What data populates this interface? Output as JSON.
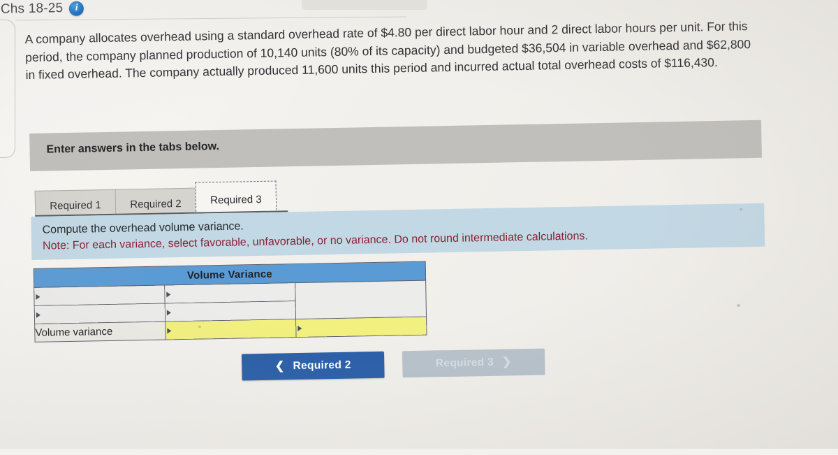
{
  "header": {
    "title": "Chs 18-25",
    "info_icon": "info-circle-icon"
  },
  "problem": {
    "text": "A company allocates overhead using a standard overhead rate of $4.80 per direct labor hour and 2 direct labor hours per unit. For this period, the company planned production of 10,140 units (80% of its capacity) and budgeted $36,504 in variable overhead and $62,800 in fixed overhead. The company actually produced 11,600 units this period and incurred actual total overhead costs of $116,430."
  },
  "instruction_band": {
    "text": "Enter answers in the tabs below."
  },
  "tabs": [
    {
      "label": "Required 1",
      "active": false
    },
    {
      "label": "Required 2",
      "active": false
    },
    {
      "label": "Required 3",
      "active": true
    }
  ],
  "panel": {
    "line1": "Compute the overhead volume variance.",
    "line2": "Note: For each variance, select favorable, unfavorable, or no variance. Do not round intermediate calculations."
  },
  "table": {
    "header": "Volume Variance",
    "rows": [
      {
        "label": "",
        "col2": "",
        "col3": "",
        "type": "input"
      },
      {
        "label": "",
        "col2": "",
        "col3": "",
        "type": "input"
      },
      {
        "label": "Volume variance",
        "col2": "",
        "col3": "",
        "type": "result"
      }
    ]
  },
  "nav": {
    "prev_label": "Required 2",
    "prev_chevron": "chevron-left-icon",
    "next_label": "Required 3",
    "next_chevron": "chevron-right-icon"
  },
  "colors": {
    "table_header_blue": "#5b9bd5",
    "panel_blue": "#c2d8e4",
    "band_grey": "#c0bfbb",
    "input_yellow": "#f2f07f",
    "button_blue": "#2a5fa8",
    "button_disabled": "#b7c2cb",
    "note_red": "#8a2232"
  }
}
